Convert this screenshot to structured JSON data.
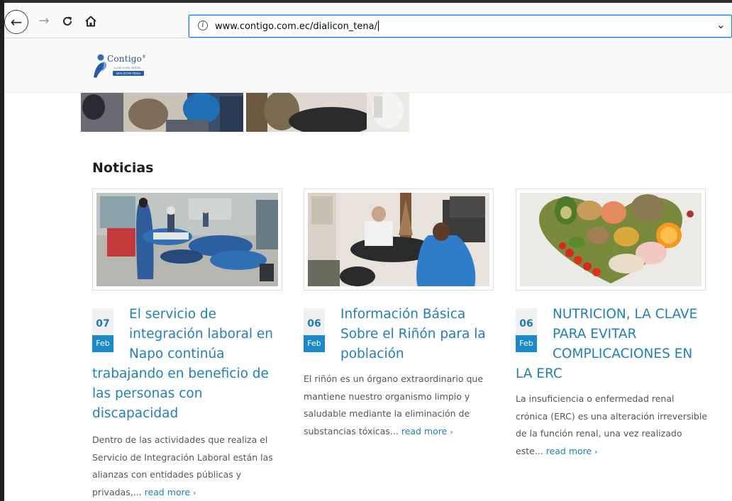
{
  "browser": {
    "url": "www.contigo.com.ec/dialicon_tena/",
    "icons": [
      "back-arrow-icon",
      "forward-arrow-icon",
      "reload-icon",
      "home-icon",
      "info-icon",
      "chevron-down-icon"
    ]
  },
  "site": {
    "logo_word": "Contigo",
    "logo_registered": "®",
    "logo_subtitle": "CLÍNICA DEL RIÑÓN",
    "logo_tag": "DIALICON TENA"
  },
  "news": {
    "title": "Noticias",
    "read_more": "read more",
    "read_more_arrow": "›",
    "items": [
      {
        "day": "07",
        "month": "Feb",
        "title_line1": "El servicio de integración laboral en Napo continúa",
        "title_line2": "trabajando en beneficio de las personas con discapacidad",
        "excerpt": "Dentro de las actividades que realiza el Servicio de Integración Laboral están las alianzas con entidades públicas y privadas,...",
        "image": "dialysis-room-photo"
      },
      {
        "day": "06",
        "month": "Feb",
        "title_line1": "Información Básica Sobre el Riñón para la población",
        "title_line2": "",
        "excerpt": "El riñón es un órgano extraordinario que mantiene nuestro organismo limpio y saludable mediante la eliminación de substancias tóxicas...",
        "image": "consultation-office-photo"
      },
      {
        "day": "06",
        "month": "Feb",
        "title_line1": "NUTRICION, LA CLAVE PARA EVITAR COMPLICACIONES EN",
        "title_line2": "LA ERC",
        "excerpt": "La insuficiencia o enfermedad renal crónica (ERC) es una alteración irreversible de la función renal, una vez realizado este...",
        "image": "healthy-food-heart-photo"
      }
    ]
  }
}
